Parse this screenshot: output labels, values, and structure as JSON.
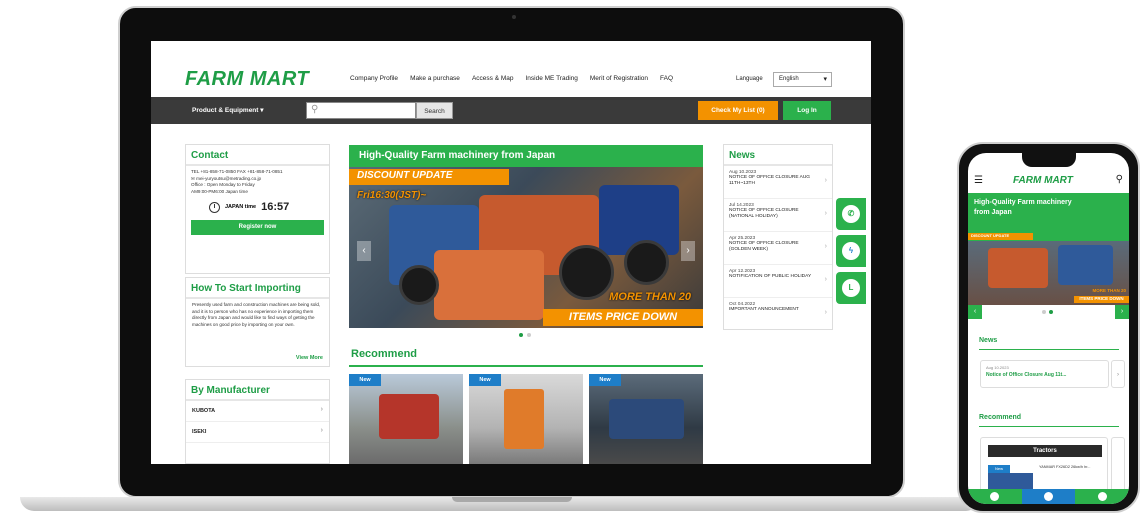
{
  "site": {
    "logo": "FARM MART",
    "nav": [
      "Company Profile",
      "Make a purchase",
      "Access & Map",
      "Inside ME Trading",
      "Merit of Registration",
      "FAQ"
    ],
    "language_label": "Language",
    "language_value": "English"
  },
  "toolbar": {
    "product_menu": "Product & Equipment",
    "search_button": "Search",
    "mylist_button": "Check My List (0)",
    "login_button": "Log In"
  },
  "contact": {
    "title": "Contact",
    "tel_fax": "TEL +81-858-71-0850    FAX +81-858-71-0851",
    "email": "mei-yuryoutsu@metrading.co.jp",
    "office_hours": "Office : Open Monday to Friday",
    "office_time": "AM9:00-PM6:00 Japan time",
    "time_label": "JAPAN time",
    "time_value": "16:57",
    "register_button": "Register now"
  },
  "howto": {
    "title": "How To Start Importing",
    "text": "Presently used farm and construction machines are being sold, and it is to person who has no experience in importing them directly from Japan and would like to find ways of getting the machines on good price by importing on your own.",
    "view_more": "View More"
  },
  "manufacturer": {
    "title": "By Manufacturer",
    "items": [
      "KUBOTA",
      "ISEKI"
    ]
  },
  "banner": {
    "title": "High-Quality Farm machinery from Japan",
    "discount": "DISCOUNT UPDATE",
    "date": "Fri16:30(JST)~",
    "more": "MORE THAN 20",
    "price_down": "ITEMS PRICE DOWN"
  },
  "recommend": {
    "title": "Recommend",
    "badge": "New"
  },
  "news": {
    "title": "News",
    "items": [
      {
        "date": "Aug 10.2023",
        "text": "NOTICE OF OFFICE CLOSURE AUG 11TH~13TH"
      },
      {
        "date": "Jul 14.2023",
        "text": "NOTICE OF OFFICE CLOSURE (NATIONAL HOLIDAY)"
      },
      {
        "date": "Apr 25.2023",
        "text": "NOTICE OF OFFICE CLOSURE (GOLDEN WEEK)"
      },
      {
        "date": "Apr 12.2023",
        "text": "NOTIFICATION OF PUBLIC HOLIDAY"
      },
      {
        "date": "Oct 04.2022",
        "text": "IMPORTANT ANNOUNCEMENT"
      }
    ]
  },
  "social": {
    "whatsapp": "WhatsApp",
    "messenger": "Messenger",
    "line": "LINE"
  },
  "mobile": {
    "logo": "FARM MART",
    "hero_title": "High-Quality Farm machinery from Japan",
    "discount": "DISCOUNT UPDATE",
    "more": "MORE THAN 20",
    "price_down": "ITEMS PRICE DOWN",
    "news_title": "News",
    "news_date": "Aug 10.2023",
    "news_text": "Notice of Office Closure Aug 11t...",
    "recommend_title": "Recommend",
    "tractors_label": "Tractors",
    "new_badge": "New",
    "rec_text": "YANMAR FX26D2 26kw/h hr..."
  },
  "colors": {
    "brand_green": "#2bb14c",
    "accent_orange": "#f39200",
    "dark_bar": "#3a3a3a"
  }
}
